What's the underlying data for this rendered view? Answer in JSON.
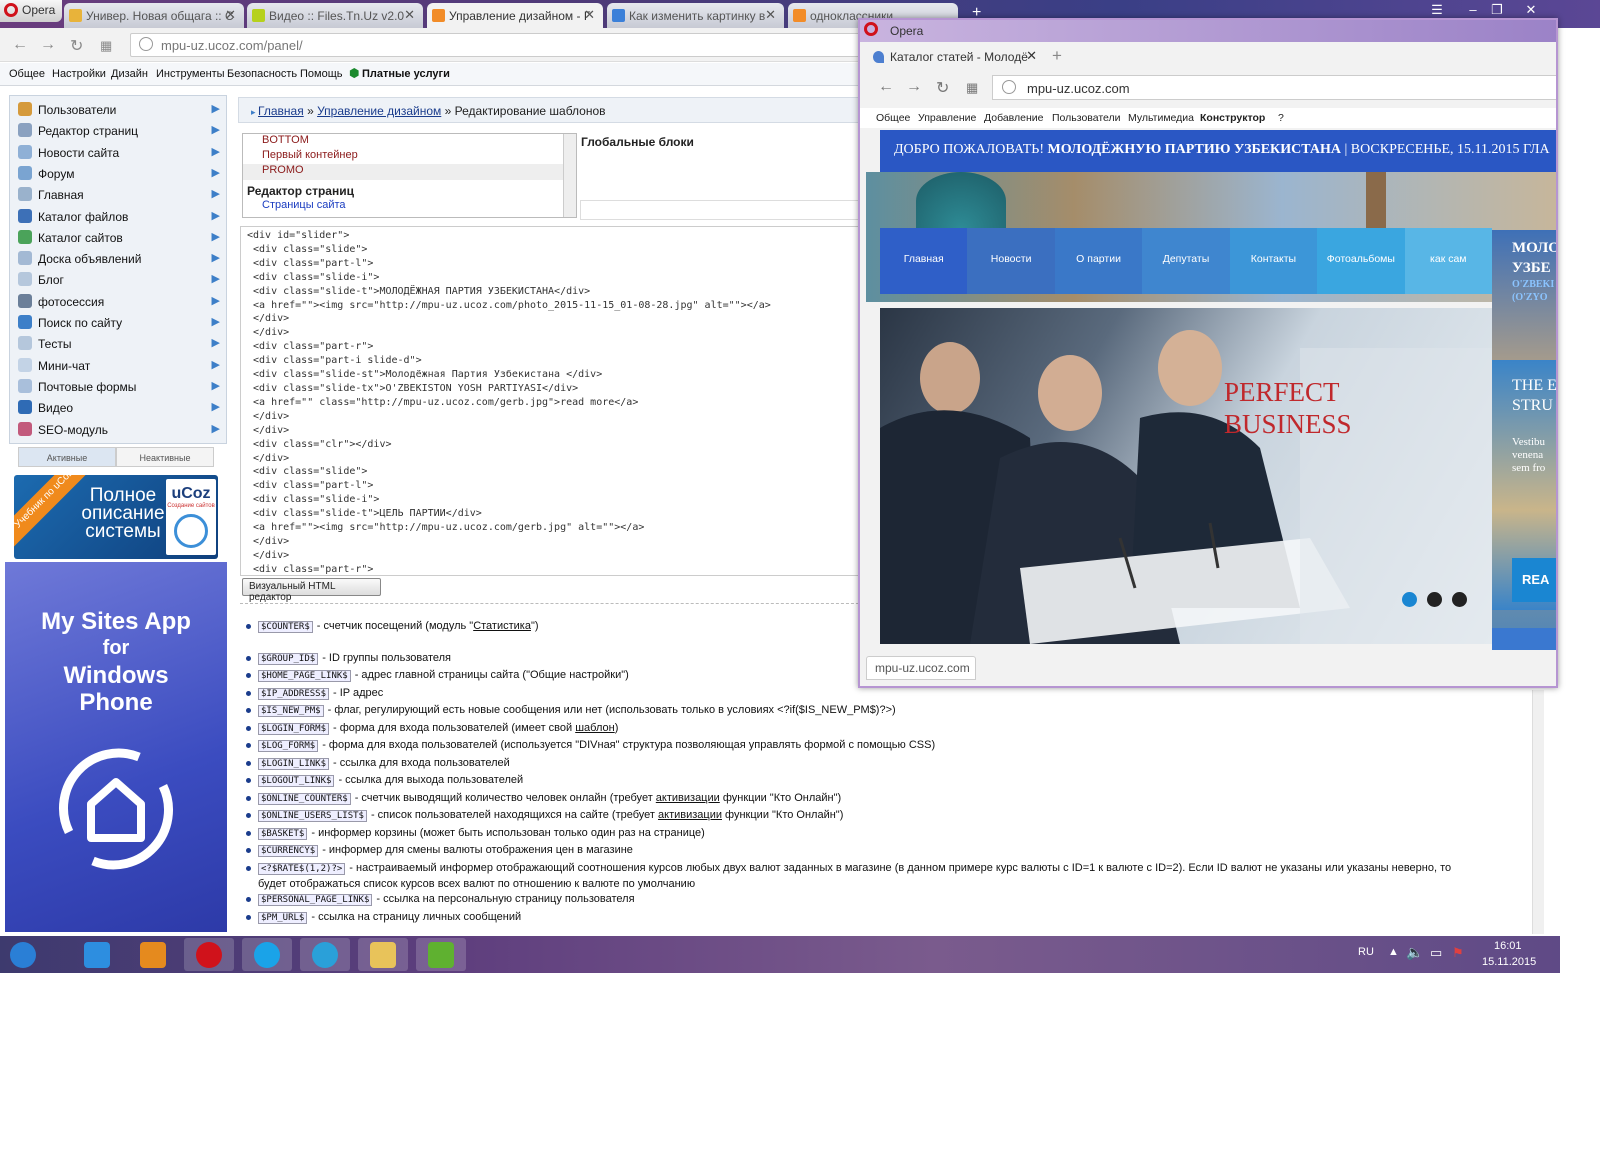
{
  "browser": {
    "opera_label": "Opera",
    "tabs": [
      {
        "label": "Универ. Новая общага :: С",
        "color": "#e8b33a"
      },
      {
        "label": "Видео :: Files.Tn.Uz v2.0",
        "color": "#b6d11c"
      },
      {
        "label": "Управление дизайном - Г",
        "color": "#f28c28"
      },
      {
        "label": "Как изменить картинку в",
        "color": "#3b80d9"
      },
      {
        "label": "одноклассники",
        "color": "#f28c28"
      }
    ],
    "new_tab": "+",
    "url": "mpu-uz.ucoz.com/panel/",
    "window_controls": [
      "☰",
      "‒",
      "❐",
      "✕"
    ]
  },
  "menu": {
    "items": [
      "Общее",
      "Настройки",
      "Дизайн",
      "Инструменты",
      "Безопасность",
      "Помощь"
    ],
    "paid": "Платные услуги"
  },
  "sidebar": {
    "items": [
      {
        "label": "Пользователи",
        "icon": "users-icon",
        "color": "#d59a3c"
      },
      {
        "label": "Редактор страниц",
        "icon": "page-icon",
        "color": "#8aa1c0"
      },
      {
        "label": "Новости сайта",
        "icon": "bulb-icon",
        "color": "#8fb0d6"
      },
      {
        "label": "Форум",
        "icon": "forum-icon",
        "color": "#7aa4d1"
      },
      {
        "label": "Главная",
        "icon": "home-icon",
        "color": "#9ab2cc"
      },
      {
        "label": "Каталог файлов",
        "icon": "disk-icon",
        "color": "#3d70b7"
      },
      {
        "label": "Каталог сайтов",
        "icon": "globe-icon",
        "color": "#4ba35a"
      },
      {
        "label": "Доска объявлений",
        "icon": "board-icon",
        "color": "#a3b9d4"
      },
      {
        "label": "Блог",
        "icon": "blog-icon",
        "color": "#b5c7dc"
      },
      {
        "label": "фотосессия",
        "icon": "camera-icon",
        "color": "#6b7f99"
      },
      {
        "label": "Поиск по сайту",
        "icon": "search-icon",
        "color": "#3d7fc8"
      },
      {
        "label": "Тесты",
        "icon": "test-icon",
        "color": "#b5c7dc"
      },
      {
        "label": "Мини-чат",
        "icon": "chat-icon",
        "color": "#c3d3e6"
      },
      {
        "label": "Почтовые формы",
        "icon": "mail-icon",
        "color": "#a9bfdb"
      },
      {
        "label": "Видео",
        "icon": "video-icon",
        "color": "#2f6bb5"
      },
      {
        "label": "SEO-модуль",
        "icon": "seo-icon",
        "color": "#c25a7c"
      }
    ],
    "tab_active": "Активные",
    "tab_inactive": "Неактивные"
  },
  "ucoz_banner": {
    "ribbon": "Учебник по uCoz",
    "line1": "Полное",
    "line2": "описание",
    "line3": "системы",
    "logo": "uCoz",
    "logo_sub": "Создание сайтов"
  },
  "app_banner": {
    "line1": "My Sites App",
    "line2": "for",
    "line3": "Windows",
    "line4": "Phone"
  },
  "breadcrumb": {
    "home": "Главная",
    "design": "Управление дизайном",
    "current": "Редактирование шаблонов",
    "sep": "»"
  },
  "templates": {
    "items": [
      "BOTTOM",
      "Первый контейнер",
      "PROMO"
    ],
    "group": "Редактор страниц",
    "subitem": "Страницы сайта",
    "global_blocks": "Глобальные блоки"
  },
  "code_lines": [
    "<div id=\"slider\">",
    " <div class=\"slide\">",
    " <div class=\"part-l\">",
    " <div class=\"slide-i\">",
    " <div class=\"slide-t\">МОЛОДЁЖНАЯ ПАРТИЯ УЗБЕКИСТАНА</div>",
    " <a href=\"\"><img src=\"http://mpu-uz.ucoz.com/photo_2015-11-15_01-08-28.jpg\" alt=\"\"></a>",
    " </div>",
    " </div>",
    " <div class=\"part-r\">",
    " <div class=\"part-i slide-d\">",
    " <div class=\"slide-st\">Молодёжная Партия Узбекистана </div>",
    " <div class=\"slide-tx\">O'ZBEKISTON YOSH PARTIYASI</div>",
    " <a href=\"\" class=\"http://mpu-uz.ucoz.com/gerb.jpg\">read more</a>",
    " </div>",
    " </div>",
    " <div class=\"clr\"></div>",
    " </div>",
    " <div class=\"slide\">",
    " <div class=\"part-l\">",
    " <div class=\"slide-i\">",
    " <div class=\"slide-t\">ЦЕЛЬ ПАРТИИ</div>",
    " <a href=\"\"><img src=\"http://mpu-uz.ucoz.com/gerb.jpg\" alt=\"\"></a>",
    " </div>",
    " </div>",
    " <div class=\"part-r\">"
  ],
  "visual_editor_button": "Визуальный HTML редактор",
  "variables": [
    {
      "tag": "$COUNTER$",
      "pre": "- счетчик посещений (модуль \"",
      "link": "Статистика",
      "post": "\")"
    },
    {
      "tag": "$GROUP_ID$",
      "pre": "- ID группы пользователя",
      "link": "",
      "post": ""
    },
    {
      "tag": "$HOME_PAGE_LINK$",
      "pre": "- адрес главной страницы сайта (\"Общие настройки\")",
      "link": "",
      "post": ""
    },
    {
      "tag": "$IP_ADDRESS$",
      "pre": "- IP адрес",
      "link": "",
      "post": ""
    },
    {
      "tag": "$IS_NEW_PM$",
      "pre": "- флаг, регулирующий есть новые сообщения или нет (использовать только в условиях <?if($IS_NEW_PM$)?>)",
      "link": "",
      "post": ""
    },
    {
      "tag": "$LOGIN_FORM$",
      "pre": "- форма для входа пользователей (имеет свой ",
      "link": "шаблон",
      "post": ")"
    },
    {
      "tag": "$LOG_FORM$",
      "pre": "- форма для входа пользователей (используется \"DIVная\" структура позволяющая управлять формой с помощью CSS)",
      "link": "",
      "post": ""
    },
    {
      "tag": "$LOGIN_LINK$",
      "pre": "- ссылка для входа пользователей",
      "link": "",
      "post": ""
    },
    {
      "tag": "$LOGOUT_LINK$",
      "pre": "- ссылка для выхода пользователей",
      "link": "",
      "post": ""
    },
    {
      "tag": "$ONLINE_COUNTER$",
      "pre": "- счетчик выводящий количество человек онлайн (требует ",
      "link": "активизации",
      "post": " функции \"Кто Онлайн\")"
    },
    {
      "tag": "$ONLINE_USERS_LIST$",
      "pre": "- список пользователей находящихся на сайте (требует ",
      "link": "активизации",
      "post": " функции \"Кто Онлайн\")"
    },
    {
      "tag": "$BASKET$",
      "pre": "- информер корзины (может быть использован только один раз на странице)",
      "link": "",
      "post": ""
    },
    {
      "tag": "$CURRENCY$",
      "pre": "- информер для смены валюты отображения цен в магазине",
      "link": "",
      "post": ""
    },
    {
      "tag": "<?$RATE$(1,2)?>",
      "pre": "- настраиваемый информер отображающий соотношения курсов любых двух валют заданных в магазине (в данном примере курс валюты с ID=1 к валюте с ID=2). Если ID валют не указаны или указаны неверно, то",
      "link": "",
      "post": ""
    },
    {
      "tag": "",
      "pre": "будет отображаться список курсов всех валют по отношению к валюте по умолчанию",
      "link": "",
      "post": ""
    },
    {
      "tag": "$PERSONAL_PAGE_LINK$",
      "pre": "- ссылка на персональную страницу пользователя",
      "link": "",
      "post": ""
    },
    {
      "tag": "$PM_URL$",
      "pre": "- ссылка на страницу личных сообщений",
      "link": "",
      "post": ""
    }
  ],
  "popup": {
    "opera_label": "Opera",
    "tab_label": "Каталог статей - Молодё",
    "new_tab": "+",
    "url": "mpu-uz.ucoz.com",
    "menu": [
      "Общее",
      "Управление",
      "Добавление",
      "Пользователи",
      "Мультимедиа",
      "Конструктор",
      "?"
    ],
    "banner_pre": "ДОБРО ПОЖАЛОВАТЬ!",
    "banner_bold": "МОЛОДЁЖНУЮ ПАРТИЮ УЗБЕКИСТАНА",
    "banner_post": "| ВОСКРЕСЕНЬЕ, 15.11.2015 ГЛА",
    "nav": [
      "Главная",
      "Новости",
      "О партии",
      "Депутаты",
      "Контакты",
      "Фотоальбомы",
      "как сам"
    ],
    "nav_colors": [
      "#2f5fc8",
      "#3b6fc0",
      "#3a78c8",
      "#3f86cf",
      "#3c96d8",
      "#3aa6e0",
      "#58b6e6"
    ],
    "slide_title1": "PERFECT",
    "slide_title2": "BUSINESS",
    "side_text1": "МОЛО",
    "side_text2": "УЗБЕ",
    "side_text3": "O'ZBEKI",
    "side_text4": "(O'ZYO",
    "side_text5": "THE E",
    "side_text6": "STRU",
    "side_text7": "Vestibu",
    "side_text8": "venena",
    "side_text9": "sem fro",
    "side_btn": "REA",
    "status_url": "mpu-uz.ucoz.com"
  },
  "taskbar": {
    "apps": [
      {
        "name": "start-orb-icon",
        "color": "#2a7fd6"
      },
      {
        "name": "ie-icon",
        "color": "#2d8ee0"
      },
      {
        "name": "media-player-icon",
        "color": "#e58a1e"
      },
      {
        "name": "opera-icon",
        "color": "#d0121b"
      },
      {
        "name": "skype-icon",
        "color": "#1aa3e8"
      },
      {
        "name": "telegram-icon",
        "color": "#2aa0d9"
      },
      {
        "name": "explorer-icon",
        "color": "#e8c35a"
      },
      {
        "name": "bluestacks-icon",
        "color": "#5fb130"
      }
    ],
    "lang": "RU",
    "time": "16:01",
    "date": "15.11.2015"
  }
}
